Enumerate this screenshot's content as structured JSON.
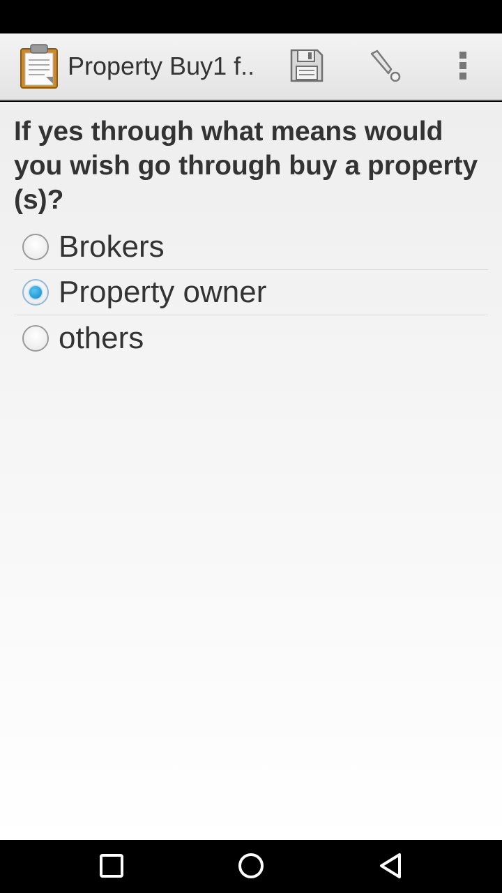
{
  "app": {
    "title": "Property Buy1 f.."
  },
  "toolbar": {
    "save_icon": "save-disk-icon",
    "pen_icon": "pen-go-to-icon",
    "menu_icon": "overflow-menu-icon"
  },
  "question": {
    "text": "If yes through what means would you wish go through buy a property (s)?"
  },
  "options": [
    {
      "label": "Brokers",
      "selected": false
    },
    {
      "label": "Property owner",
      "selected": true
    },
    {
      "label": "others",
      "selected": false
    }
  ],
  "colors": {
    "accent": "#1a9ad6",
    "text": "#333333"
  },
  "nav": {
    "recent_icon": "recent-apps-icon",
    "home_icon": "home-icon",
    "back_icon": "back-icon"
  }
}
